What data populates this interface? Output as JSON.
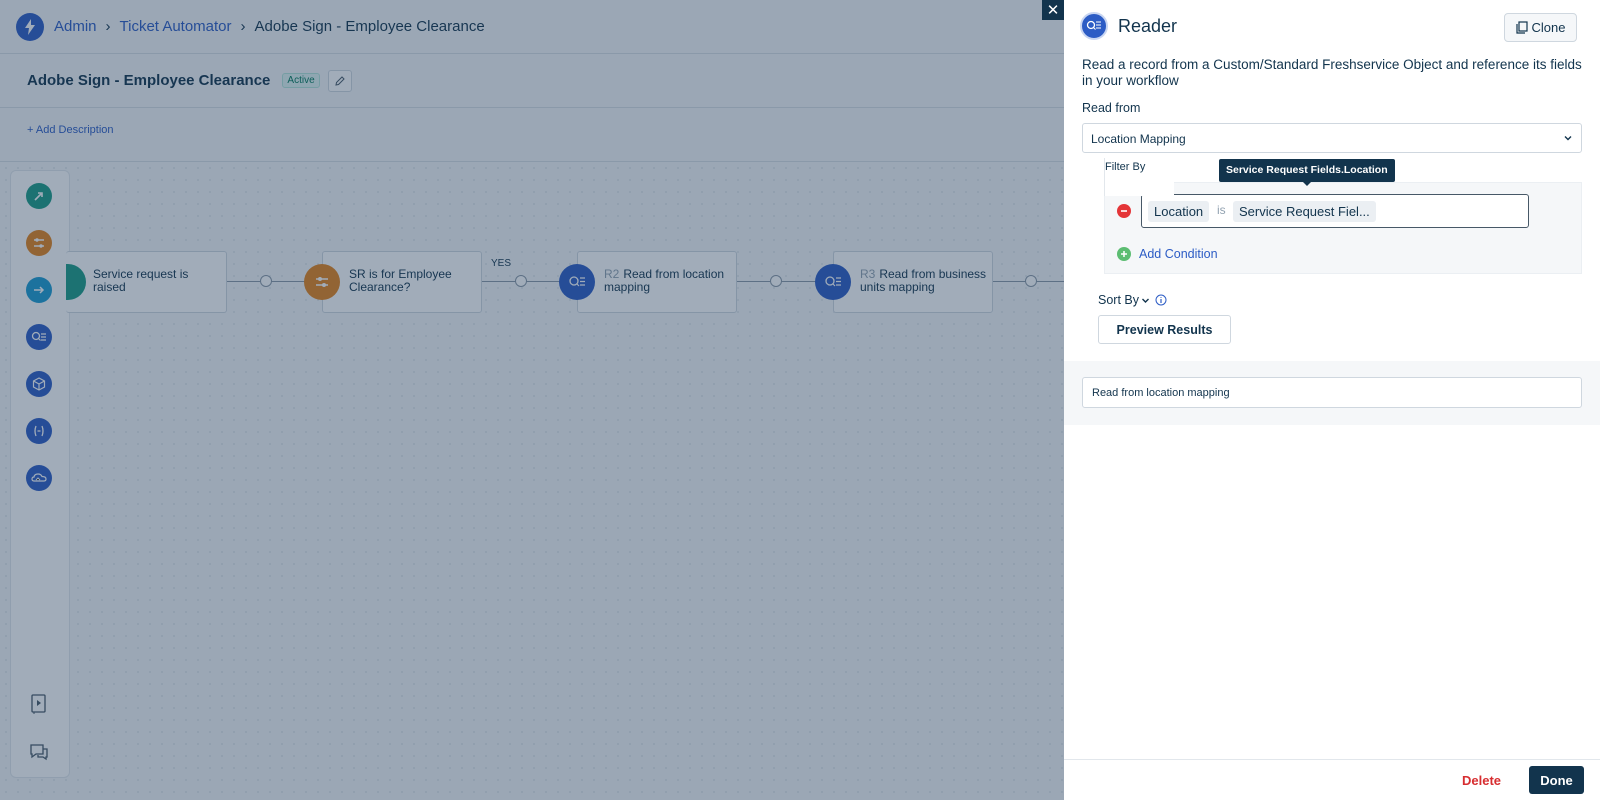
{
  "breadcrumb": {
    "items": [
      {
        "label": "Admin"
      },
      {
        "label": "Ticket Automator"
      },
      {
        "label": "Adobe Sign - Employee Clearance"
      }
    ]
  },
  "workflow": {
    "title": "Adobe Sign - Employee Clearance",
    "status": "Active",
    "add_description": "+ Add Description"
  },
  "tools": [
    {
      "icon": "event-icon",
      "color": "#1b9c85"
    },
    {
      "icon": "condition-icon",
      "color": "#e5831b"
    },
    {
      "icon": "action-icon",
      "color": "#1a9bd1"
    },
    {
      "icon": "reader-icon",
      "color": "#2c5cc5"
    },
    {
      "icon": "app-icon",
      "color": "#2c5cc5"
    },
    {
      "icon": "expression-icon",
      "color": "#2c5cc5"
    },
    {
      "icon": "web-request-icon",
      "color": "#2c5cc5"
    },
    {
      "icon": "video-guide-icon"
    },
    {
      "icon": "chat-icon"
    }
  ],
  "flow": {
    "nodes": [
      {
        "num": "",
        "text": "Service request is raised"
      },
      {
        "num": "",
        "text": "SR is for Employee Clearance?"
      },
      {
        "num": "R2",
        "text": "Read from location mapping"
      },
      {
        "num": "R3",
        "text": "Read from business units mapping"
      }
    ],
    "yes_label": "YES"
  },
  "panel": {
    "title": "Reader",
    "clone_label": "Clone",
    "description": "Read a record from a Custom/Standard Freshservice Object and reference its fields in your workflow",
    "read_from_label": "Read from",
    "read_from_value": "Location Mapping",
    "filter_by_label": "Filter By",
    "condition": {
      "field": "Location",
      "operator": "is",
      "value": "Service Request Fiel..."
    },
    "tooltip": "Service Request Fields.Location",
    "add_condition_label": "Add Condition",
    "sort_by_label": "Sort By",
    "preview_label": "Preview Results",
    "node_name": "Read from location mapping",
    "delete_label": "Delete",
    "done_label": "Done"
  },
  "colors": {
    "primary": "#2c5cc5",
    "dark": "#12344d",
    "danger": "#d72d30",
    "success": "#5cbd72"
  }
}
